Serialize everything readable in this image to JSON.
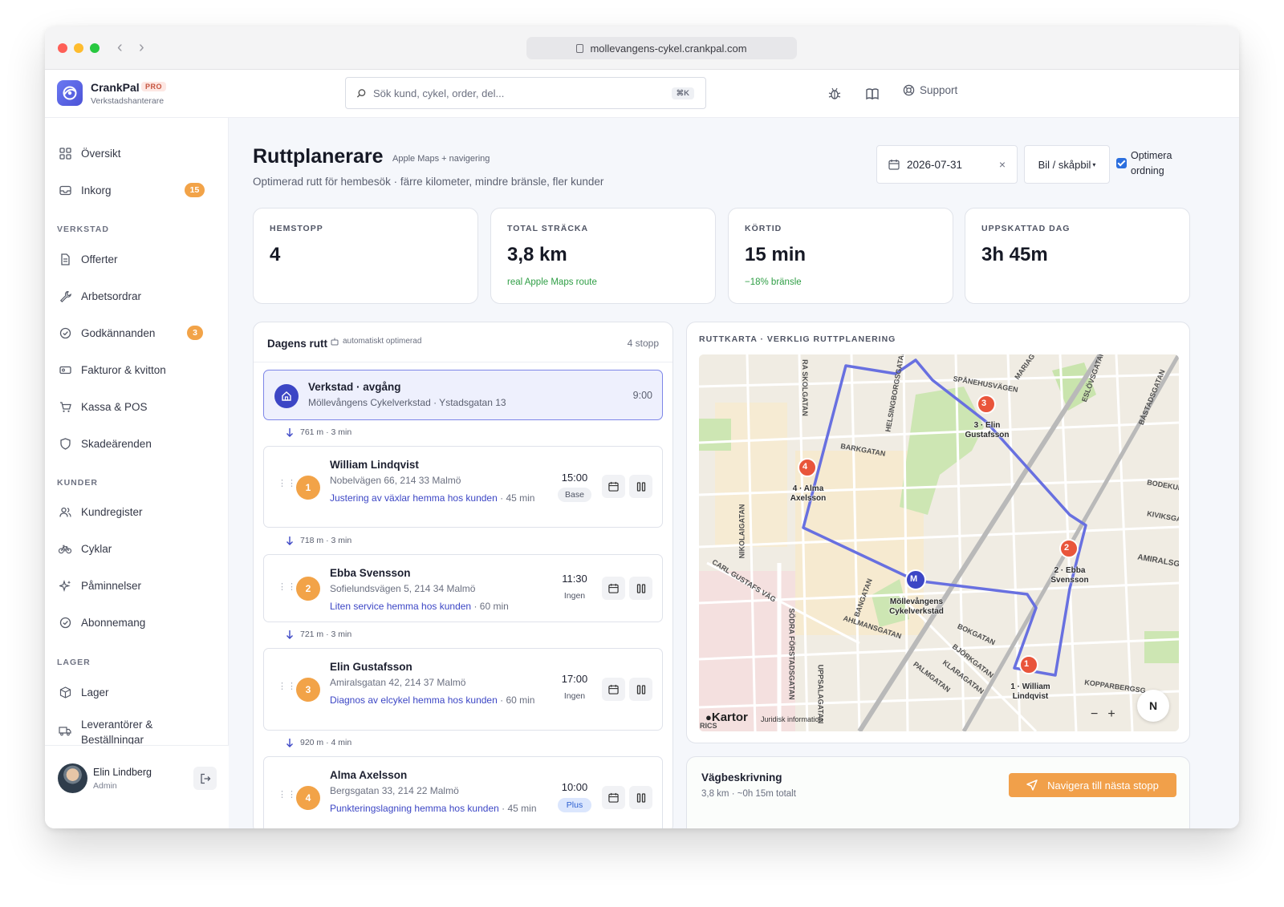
{
  "browser": {
    "url": "mollevangens-cykel.crankpal.com",
    "back": "‹",
    "forward": "›"
  },
  "brand": {
    "name": "CrankPal",
    "badge": "PRO",
    "subtitle": "Verkstadshanterare"
  },
  "search": {
    "placeholder": "Sök kund, cykel, order, del...",
    "shortcut": "⌘K"
  },
  "header": {
    "icons": [
      "bug-icon",
      "book-icon"
    ],
    "support_label": "Support"
  },
  "sidebar": {
    "items": [
      {
        "label": "Översikt",
        "icon": "grid-icon"
      },
      {
        "label": "Inkorg",
        "icon": "inbox-icon",
        "badge": "15"
      }
    ],
    "sections": [
      {
        "title": "VERKSTAD",
        "items": [
          {
            "label": "Offerter",
            "icon": "document-icon"
          },
          {
            "label": "Arbetsordrar",
            "icon": "wrench-icon"
          },
          {
            "label": "Godkännanden",
            "icon": "check-circle-icon",
            "badge": "3"
          },
          {
            "label": "Fakturor & kvitton",
            "icon": "receipt-icon"
          },
          {
            "label": "Kassa & POS",
            "icon": "cart-icon"
          },
          {
            "label": "Skadeärenden",
            "icon": "shield-icon"
          }
        ]
      },
      {
        "title": "KUNDER",
        "items": [
          {
            "label": "Kundregister",
            "icon": "users-icon"
          },
          {
            "label": "Cyklar",
            "icon": "bike-icon"
          },
          {
            "label": "Påminnelser",
            "icon": "sparkle-icon"
          },
          {
            "label": "Abonnemang",
            "icon": "check-circle-icon"
          }
        ]
      },
      {
        "title": "LAGER",
        "items": [
          {
            "label": "Lager",
            "icon": "box-icon"
          },
          {
            "label": "Leverantörer & Beställningar",
            "icon": "truck-icon"
          }
        ]
      }
    ],
    "user": {
      "name": "Elin Lindberg",
      "role": "Admin"
    }
  },
  "page": {
    "title": "Ruttplanerare",
    "title_sub": "Apple Maps + navigering",
    "description": "Optimerad rutt för hembesök · färre kilometer, mindre bränsle, fler kunder",
    "date_value": "2026-07-31",
    "date_clear": "×",
    "vehicle": "Bil / skåpbil",
    "vehicle_arrow": "▾",
    "optimize_label": "Optimera ordning",
    "optimize_checked": true
  },
  "stats": [
    {
      "label": "HEMSTOPP",
      "value": "4",
      "note": ""
    },
    {
      "label": "TOTAL STRÄCKA",
      "value": "3,8 km",
      "note": "real Apple Maps route"
    },
    {
      "label": "KÖRTID",
      "value": "15 min",
      "note": "−18% bränsle"
    },
    {
      "label": "UPPSKATTAD DAG",
      "value": "3h 45m",
      "note": ""
    }
  ],
  "route": {
    "title": "Dagens rutt",
    "tag": "automatiskt optimerad",
    "count": "4 stopp",
    "depot": {
      "title": "Verkstad · avgång",
      "address": "Möllevångens Cykelverkstad · Ystadsgatan 13",
      "time": "9:00"
    },
    "legs": [
      "761 m · 3 min",
      "718 m · 3 min",
      "721 m · 3 min",
      "920 m · 4 min"
    ],
    "stops": [
      {
        "num": "1",
        "name": "William Lindqvist",
        "address": "Nobelvägen 66, 214 33 Malmö",
        "job": "Justering av växlar hemma hos kunden",
        "duration": "45 min",
        "time": "15:00",
        "plan": "Base"
      },
      {
        "num": "2",
        "name": "Ebba Svensson",
        "address": "Sofielundsvägen 5, 214 34 Malmö",
        "job": "Liten service hemma hos kunden",
        "duration": "60 min",
        "time": "11:30",
        "plan": "Ingen"
      },
      {
        "num": "3",
        "name": "Elin Gustafsson",
        "address": "Amiralsgatan 42, 214 37 Malmö",
        "job": "Diagnos av elcykel hemma hos kunden",
        "duration": "60 min",
        "time": "17:00",
        "plan": "Ingen"
      },
      {
        "num": "4",
        "name": "Alma Axelsson",
        "address": "Bergsgatan 33, 214 22 Malmö",
        "job": "Punkteringslagning hemma hos kunden",
        "duration": "45 min",
        "time": "10:00",
        "plan": "Plus"
      }
    ]
  },
  "map": {
    "title": "RUTTKARTA · VERKLIG RUTTPLANERING",
    "streets": [
      "RA SKOLGATAN",
      "HELSINGBORGSGATAN",
      "MARIAG",
      "SPÅNEHUSVÄGEN",
      "ESLÖVSGATAN",
      "BÅSTADSGATAN",
      "BARKGATAN",
      "BODEKUL",
      "KIVIKSGA",
      "AMIRALSG",
      "NIKOLAIGATAN",
      "CARL GUSTAFS VÄG",
      "BANGATAN",
      "AHLMANSGATAN",
      "SÖDRA FÖRSTADSGATAN",
      "UPPSALAGATAN",
      "BOKGATAN",
      "BJÖRKGATAN",
      "KLARAGATAN",
      "PALMGATAN",
      "KOPPARBERGSG",
      "RICS"
    ],
    "pins": [
      {
        "num": "M",
        "label": "Möllevångens Cykelverkstad",
        "kind": "depot"
      },
      {
        "num": "1",
        "label": "1 · William Lindqvist"
      },
      {
        "num": "2",
        "label": "2 · Ebba Svensson"
      },
      {
        "num": "3",
        "label": "3 · Elin Gustafsson"
      },
      {
        "num": "4",
        "label": "4 · Alma Axelsson"
      }
    ],
    "brand": "Kartor",
    "legal": "Juridisk information",
    "zoom_out": "−",
    "zoom_in": "+",
    "compass": "N",
    "colors": {
      "route": "#6870e0",
      "pin": "#e9553b",
      "depot": "#3c46c5"
    }
  },
  "directions": {
    "title": "Vägbeskrivning",
    "summary": "3,8 km · ~0h 15m totalt",
    "nav_button": "Navigera till nästa stopp"
  },
  "colors": {
    "accent": "#3c46c5",
    "orange": "#f2a348",
    "green": "#2f9e45"
  }
}
